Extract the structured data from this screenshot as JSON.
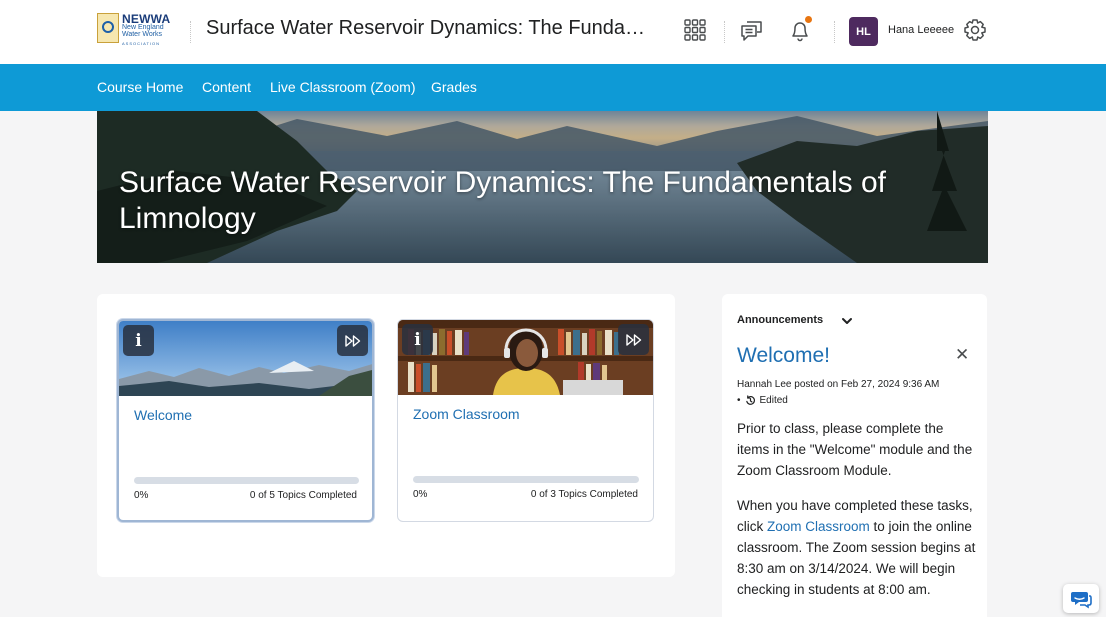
{
  "header": {
    "logo": {
      "name": "NEWWA",
      "line1": "New England",
      "line2": "Water Works",
      "line3": "ASSOCIATION"
    },
    "course_title": "Surface Water Reservoir Dynamics: The Fundament...",
    "user": {
      "initials": "HL",
      "name": "Hana Leeeee"
    },
    "icons": [
      "app-grid-icon",
      "messages-icon",
      "notifications-icon",
      "settings-icon"
    ],
    "notification_dot_color": "#e87511"
  },
  "nav": {
    "items": [
      "Course Home",
      "Content",
      "Live Classroom (Zoom)",
      "Grades"
    ],
    "bar_color": "#0e9ad6"
  },
  "banner": {
    "title": "Surface Water Reservoir Dynamics: The Fundamentals of Limnology"
  },
  "modules": [
    {
      "title": "Welcome",
      "progress_percent": 0,
      "progress_label": "0%",
      "topics_label": "0 of 5 Topics Completed",
      "selected": true
    },
    {
      "title": "Zoom Classroom",
      "progress_percent": 0,
      "progress_label": "0%",
      "topics_label": "0 of 3 Topics Completed",
      "selected": false
    }
  ],
  "announcements": {
    "heading": "Announcements",
    "item": {
      "title": "Welcome!",
      "meta": "Hannah Lee posted on Feb 27, 2024 9:36 AM",
      "edited": "Edited",
      "paragraph1": "Prior to class, please complete the items in the \"Welcome\" module and the Zoom Classroom Module.",
      "paragraph2_before": "When you have completed these tasks, click ",
      "paragraph2_link": "Zoom Classroom",
      "paragraph2_after": " to join the online classroom. The Zoom session begins at 8:30 am on 3/14/2024. We will begin checking in students at 8:00 am."
    }
  },
  "colors": {
    "link": "#1f6fb2",
    "avatar_bg": "#4e2a5f",
    "page_bg": "#f5f5f6"
  }
}
